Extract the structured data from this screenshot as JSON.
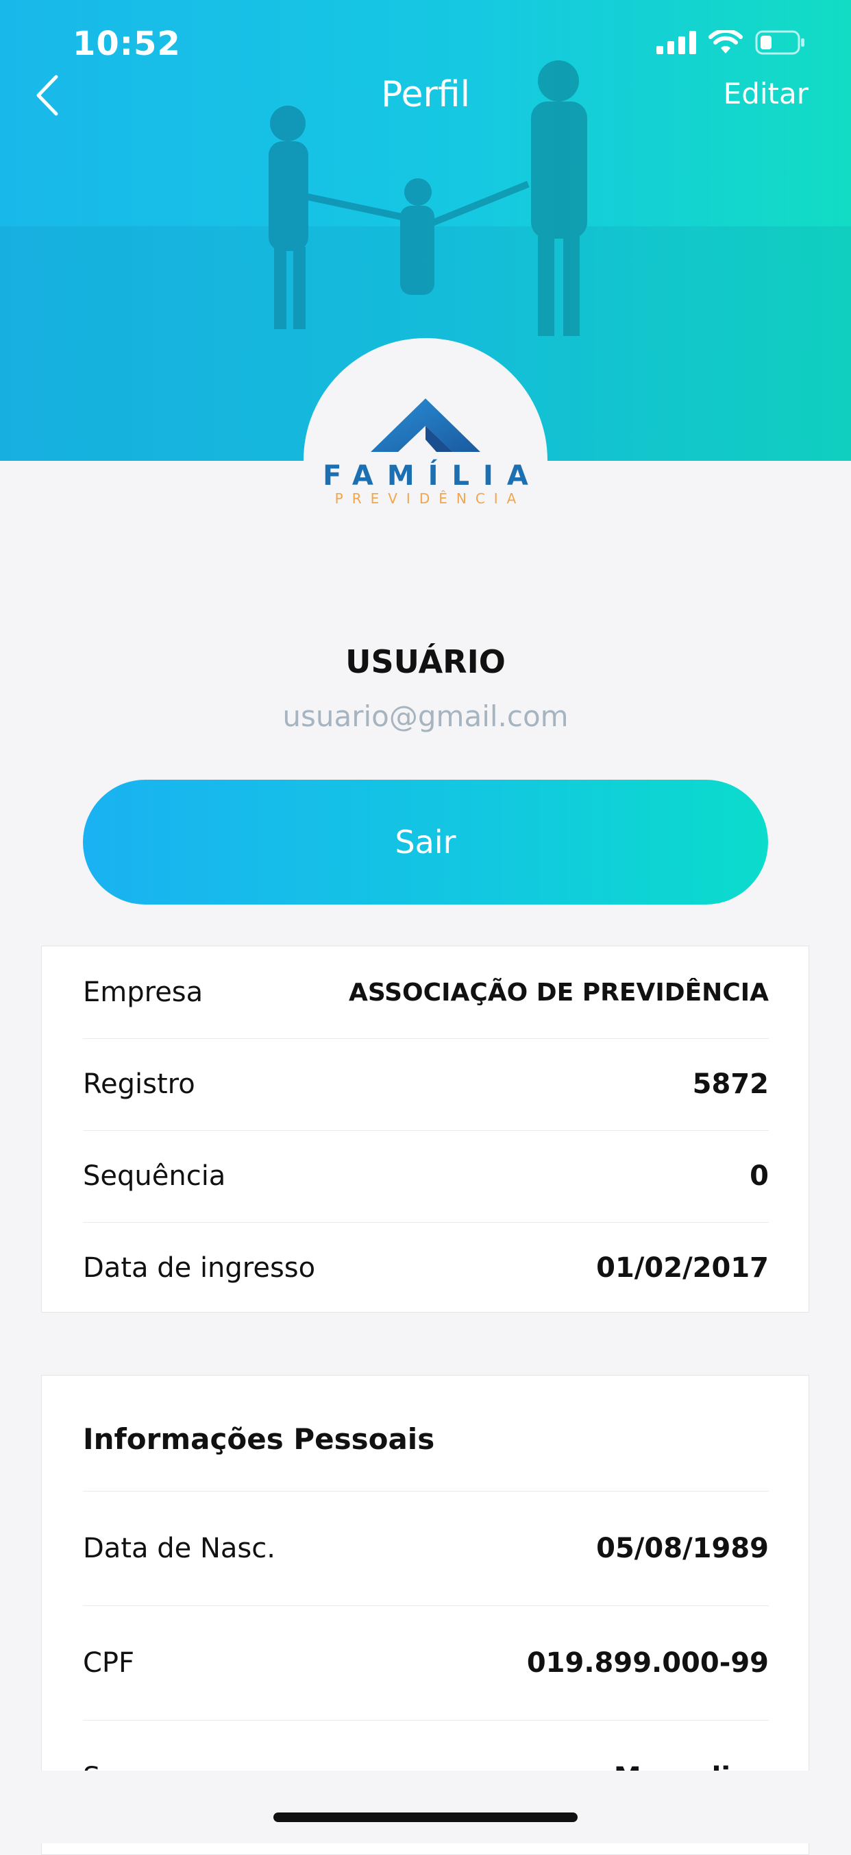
{
  "status_bar": {
    "time": "10:52"
  },
  "nav": {
    "title": "Perfil",
    "edit_label": "Editar"
  },
  "logo": {
    "name": "FAMÍLIA",
    "tagline": "PREVIDÊNCIA"
  },
  "user": {
    "name": "USUÁRIO",
    "email": "usuario@gmail.com"
  },
  "logout_button": "Sair",
  "account_rows": [
    {
      "label": "Empresa",
      "value": "ASSOCIAÇÃO DE PREVIDÊNCIA"
    },
    {
      "label": "Registro",
      "value": "5872"
    },
    {
      "label": "Sequência",
      "value": "0"
    },
    {
      "label": "Data de ingresso",
      "value": "01/02/2017"
    }
  ],
  "personal": {
    "title": "Informações Pessoais",
    "rows": [
      {
        "label": "Data de Nasc.",
        "value": "05/08/1989"
      },
      {
        "label": "CPF",
        "value": "019.899.000-99"
      },
      {
        "label": "Sexo",
        "value": "Masculino"
      }
    ]
  },
  "colors": {
    "gradient_start": "#19b8ea",
    "gradient_end": "#12dcc4",
    "logo_blue": "#1c6fb1",
    "logo_orange": "#f2a54a"
  }
}
